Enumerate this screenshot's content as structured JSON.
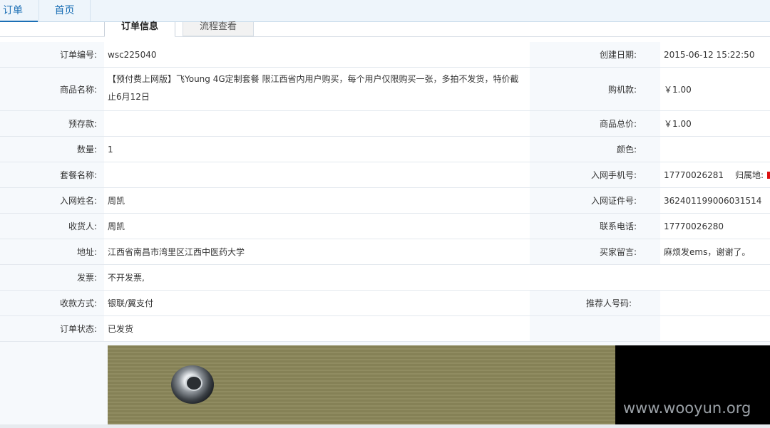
{
  "top_tabs": [
    "订单",
    "首页"
  ],
  "sub_tabs": [
    "订单信息",
    "流程查看"
  ],
  "rows": [
    {
      "l1": "订单编号:",
      "v1": "wsc225040",
      "l2": "创建日期:",
      "v2": "2015-06-12 15:22:50"
    },
    {
      "l1": "商品名称:",
      "v1": "【预付费上网版】飞Young 4G定制套餐 限江西省内用户购买，每个用户仅限购买一张，多拍不发货，特价截止6月12日",
      "l2": "购机款:",
      "v2": "￥1.00"
    },
    {
      "l1": "预存款:",
      "v1": "",
      "l2": "商品总价:",
      "v2": "￥1.00"
    },
    {
      "l1": "数量:",
      "v1": "1",
      "l2": "颜色:",
      "v2": ""
    },
    {
      "l1": "套餐名称:",
      "v1": "",
      "l2": "入网手机号:",
      "v2": "17770026281",
      "v2_extra": "归属地:"
    },
    {
      "l1": "入网姓名:",
      "v1": "周凯",
      "l2": "入网证件号:",
      "v2": "362401199006031514"
    },
    {
      "l1": "收货人:",
      "v1": "周凯",
      "l2": "联系电话:",
      "v2": "17770026280"
    },
    {
      "l1": "地址:",
      "v1": "江西省南昌市湾里区江西中医药大学",
      "l2": "买家留言:",
      "v2": "麻烦发ems，谢谢了。"
    },
    {
      "l1": "发票:",
      "v1": "不开发票,",
      "l2": "",
      "v2": ""
    },
    {
      "l1": "收款方式:",
      "v1": "银联/翼支付",
      "l2": "推荐人号码:",
      "v2": ""
    },
    {
      "l1": "订单状态:",
      "v1": "已发货",
      "l2": "",
      "v2": ""
    }
  ],
  "watermark": "www.wooyun.org"
}
